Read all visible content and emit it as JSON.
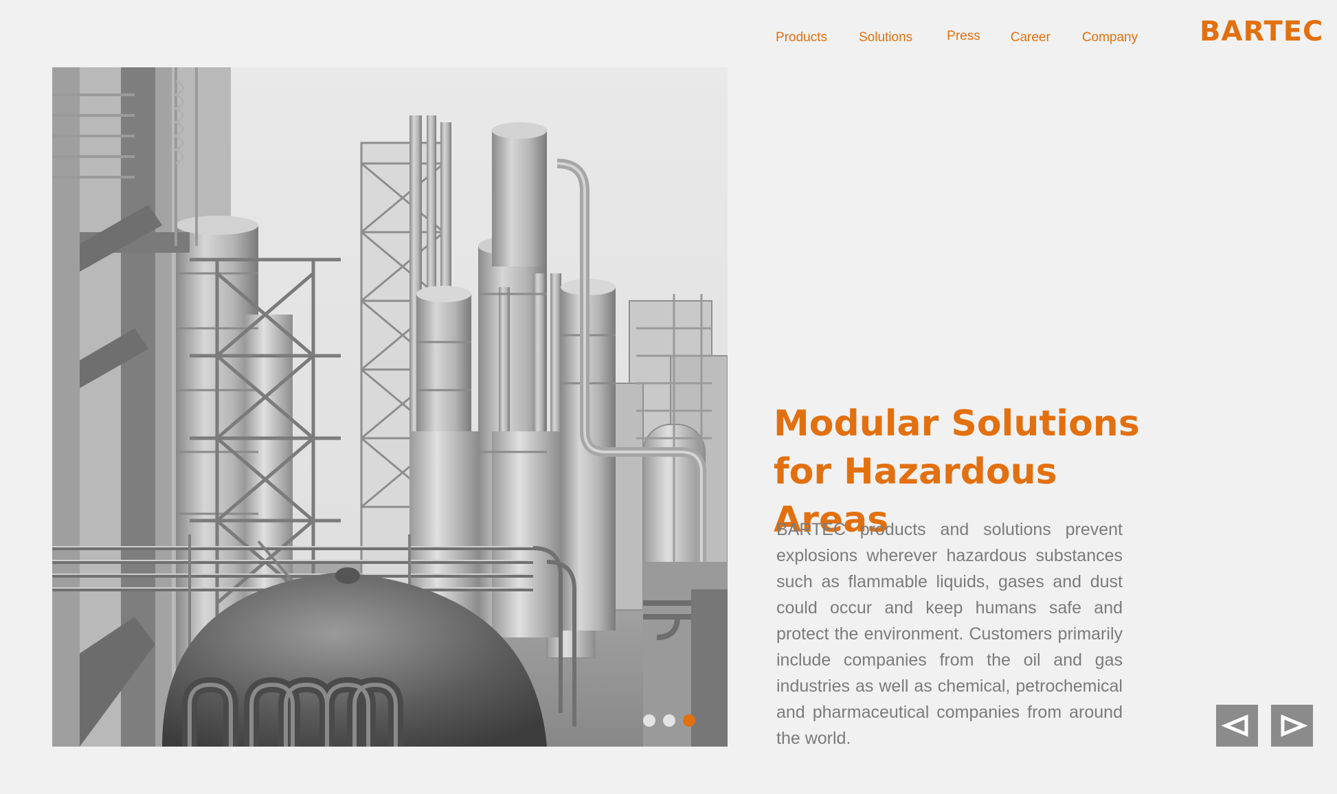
{
  "nav": {
    "items": [
      "Products",
      "Solutions",
      "Press",
      "Career",
      "Company"
    ]
  },
  "logo": {
    "text": "BARTEC"
  },
  "hero": {
    "headline_line1": "Modular Solutions",
    "headline_line2": "for Hazardous Areas",
    "body": "BARTEC products and solutions prevent explosions wherever hazardous substan­ces such as flammable liquids, gases and dust could occur and keep humans safe and protect the environment. Customers primarily include companies from the oil and gas industries as well as chemical, petrochemical and pharmaceutical com­panies from around the world."
  },
  "slider": {
    "total": 3,
    "active_index": 2,
    "prev_icon": "left-triangle-icon",
    "next_icon": "right-triangle-icon"
  },
  "colors": {
    "accent": "#e2700f",
    "background": "#f1f1f1",
    "body_text": "#7b7b7b",
    "button": "#8b8b8b"
  }
}
